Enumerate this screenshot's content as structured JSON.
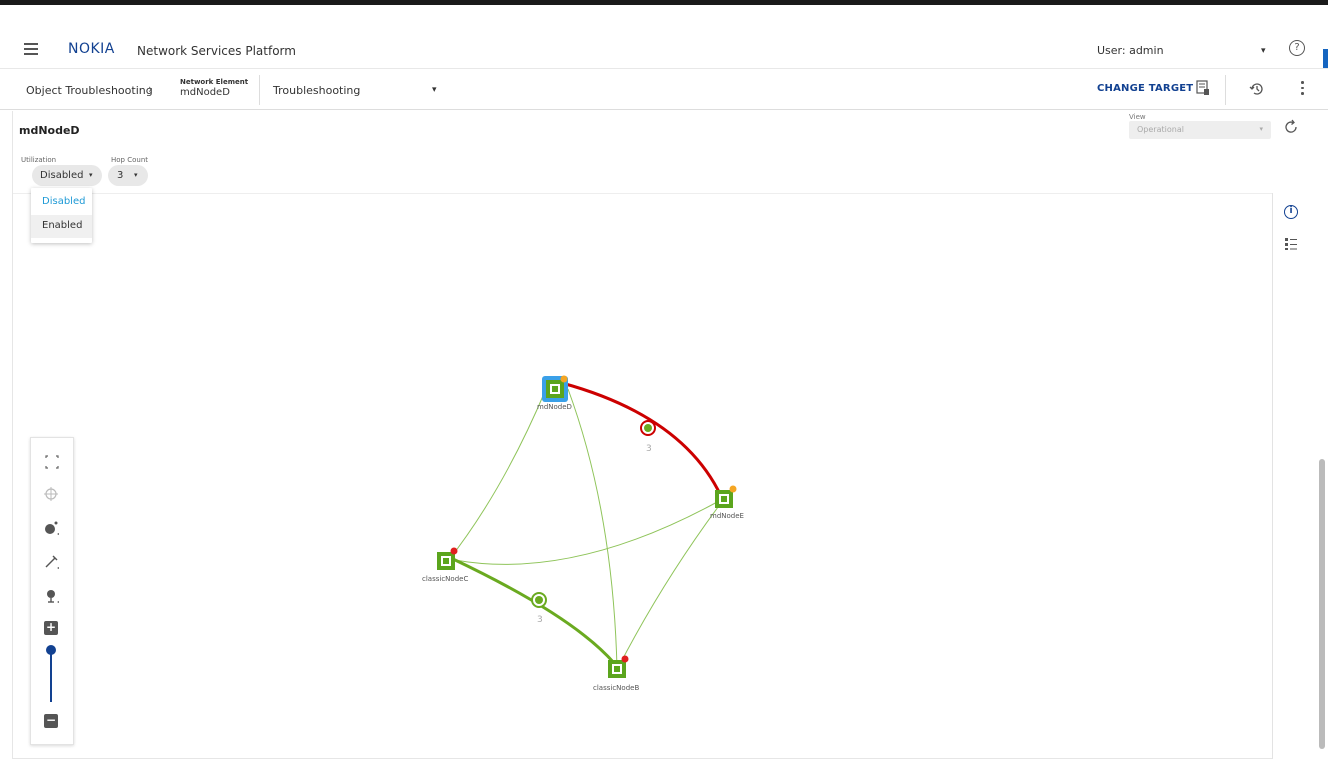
{
  "header": {
    "logo": "NOKIA",
    "app_title": "Network Services Platform",
    "user": "User: admin"
  },
  "nav": {
    "breadcrumb": "Object Troubleshooting",
    "element_label": "Network Element",
    "element_value": "mdNodeD",
    "view_selector": "Troubleshooting",
    "change_target": "CHANGE TARGET"
  },
  "panel": {
    "title": "mdNodeD",
    "view_label": "View",
    "view_value": "Operational",
    "utilization_label": "Utilization",
    "utilization_value": "Disabled",
    "hop_count_label": "Hop Count",
    "hop_count_value": "3",
    "utilization_options": [
      "Disabled",
      "Enabled"
    ]
  },
  "topology": {
    "nodes": [
      {
        "name": "mdNodeD",
        "selected": true,
        "status_color": "#f5a623"
      },
      {
        "name": "mdNodeE",
        "selected": false,
        "status_color": "#f5a623"
      },
      {
        "name": "classicNodeC",
        "selected": false,
        "status_color": "#e02020"
      },
      {
        "name": "classicNodeB",
        "selected": false,
        "status_color": "#e02020"
      }
    ],
    "links": [
      {
        "from": "mdNodeD",
        "to": "mdNodeE",
        "label": "3",
        "color": "#cc0000"
      },
      {
        "from": "classicNodeC",
        "to": "classicNodeB",
        "label": "3",
        "color": "#6aaa20"
      }
    ]
  },
  "colors": {
    "brand": "#124191",
    "node_green": "#5ba51d",
    "selected_blue": "#3aa0e8",
    "link_thin": "#8fc45a"
  }
}
